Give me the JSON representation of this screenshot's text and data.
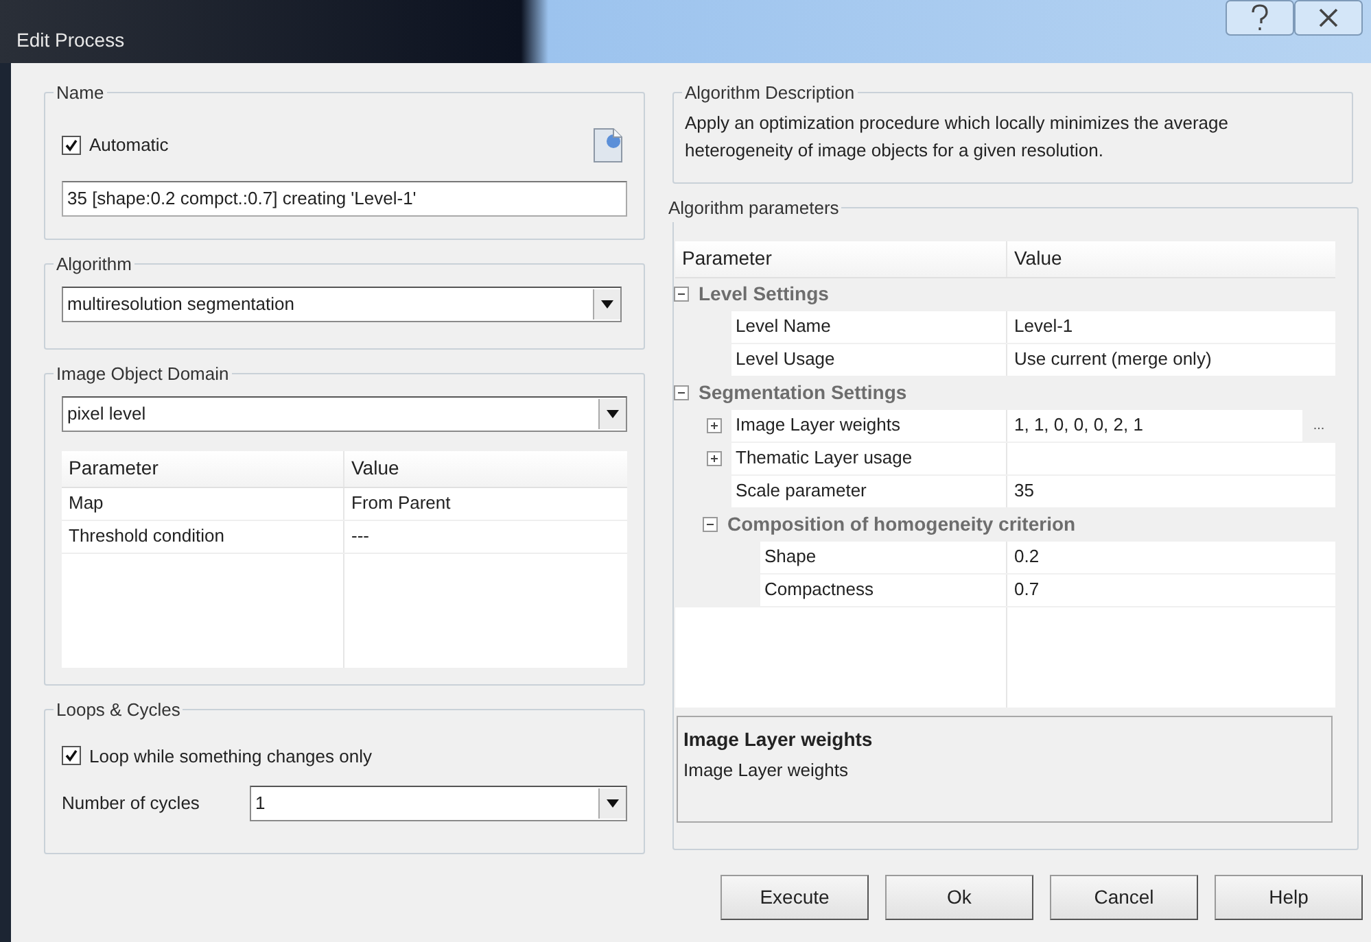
{
  "window": {
    "title": "Edit Process"
  },
  "name_group": {
    "label": "Name",
    "automatic": {
      "label": "Automatic",
      "checked": true
    },
    "value": "35 [shape:0.2 compct.:0.7] creating 'Level-1'"
  },
  "algorithm_group": {
    "label": "Algorithm",
    "value": "multiresolution segmentation"
  },
  "domain_group": {
    "label": "Image Object Domain",
    "value": "pixel level",
    "columns": [
      "Parameter",
      "Value"
    ],
    "rows": [
      {
        "parameter": "Map",
        "value": "From Parent"
      },
      {
        "parameter": "Threshold condition",
        "value": "---"
      }
    ]
  },
  "loops_group": {
    "label": "Loops & Cycles",
    "loop": {
      "label": "Loop while something changes only",
      "checked": true
    },
    "cycles_label": "Number of cycles",
    "cycles_value": "1"
  },
  "description_group": {
    "label": "Algorithm Description",
    "text": "Apply an optimization procedure which locally minimizes the average heterogeneity of image objects for a given resolution."
  },
  "parameters_group": {
    "label": "Algorithm parameters",
    "columns": [
      "Parameter",
      "Value"
    ],
    "rows": [
      {
        "kind": "category",
        "label": "Level Settings",
        "expanded": true,
        "children": [
          {
            "kind": "property",
            "label": "Level Name",
            "value": "Level-1"
          },
          {
            "kind": "property",
            "label": "Level Usage",
            "value": "Use current (merge only)"
          }
        ]
      },
      {
        "kind": "category",
        "label": "Segmentation Settings",
        "expanded": true,
        "children": [
          {
            "kind": "property",
            "label": "Image Layer weights",
            "value": "1, 1, 0, 0, 0, 2, 1",
            "expanded": false,
            "editor_button": "..."
          },
          {
            "kind": "property",
            "label": "Thematic Layer usage",
            "expanded": false
          },
          {
            "kind": "property",
            "label": "Scale parameter",
            "value": "35"
          },
          {
            "kind": "category",
            "label": "Composition of homogeneity criterion",
            "expanded": true,
            "children": [
              {
                "kind": "property",
                "label": "Shape",
                "value": "0.2"
              },
              {
                "kind": "property",
                "label": "Compactness",
                "value": "0.7"
              }
            ]
          }
        ]
      }
    ],
    "help": {
      "title": "Image Layer weights",
      "text": "Image Layer weights"
    }
  },
  "buttons": [
    "Execute",
    "Ok",
    "Cancel",
    "Help"
  ]
}
